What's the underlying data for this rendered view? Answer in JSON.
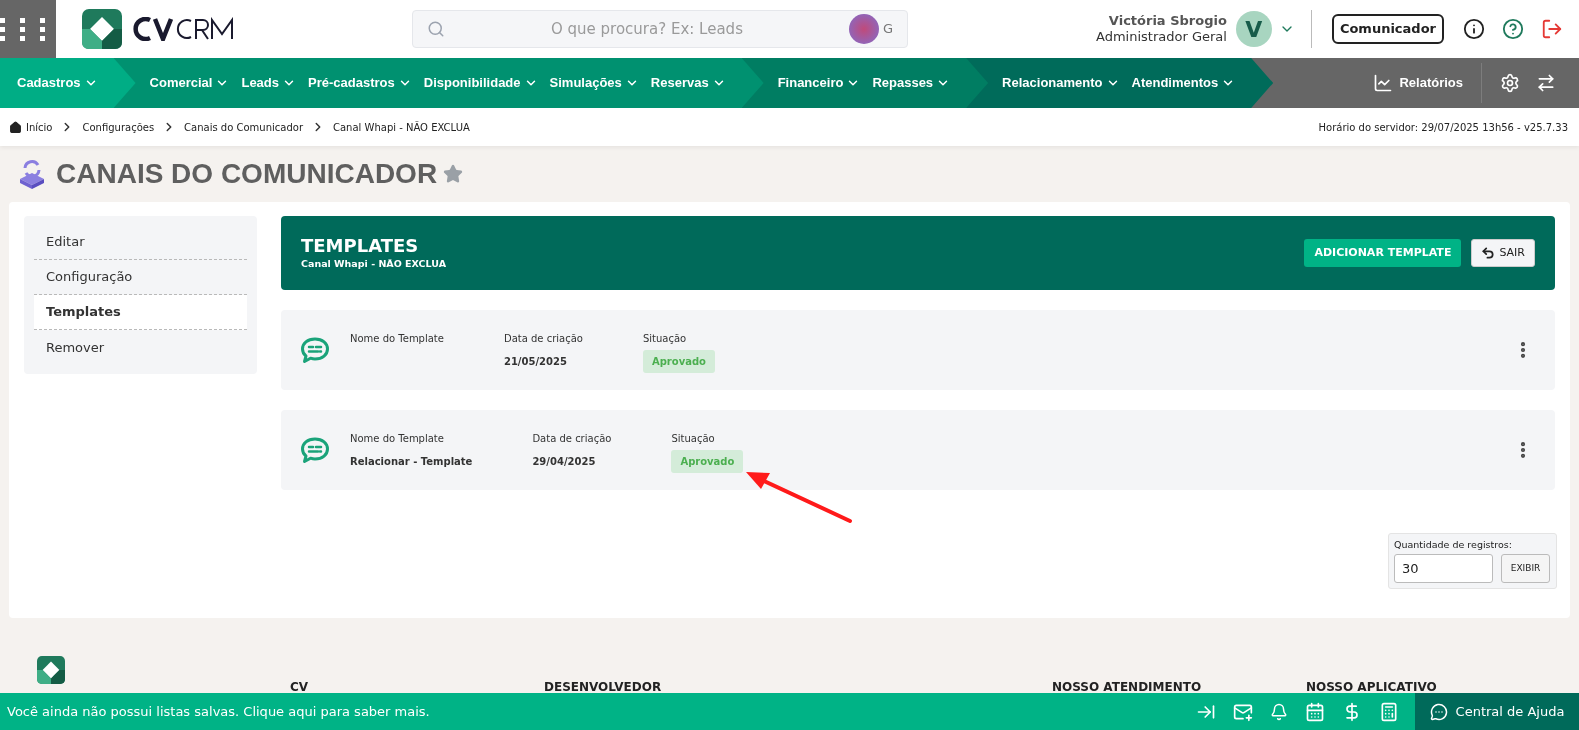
{
  "header": {
    "search": {
      "placeholder": "O que procura? Ex: Leads",
      "overlay_letter": "G"
    },
    "user": {
      "name": "Victória Sbrogio",
      "role": "Administrador Geral",
      "initial": "V"
    },
    "communicator_button": "Comunicador"
  },
  "nav": {
    "groups": [
      {
        "color": "#00ad85",
        "items": [
          "Cadastros"
        ]
      },
      {
        "color": "#009170",
        "items": [
          "Comercial",
          "Leads",
          "Pré-cadastros",
          "Disponibilidade",
          "Simulações",
          "Reservas"
        ]
      },
      {
        "color": "#007d62",
        "items": [
          "Financeiro",
          "Repasses"
        ]
      },
      {
        "color": "#006b5a",
        "items": [
          "Relacionamento",
          "Atendimentos"
        ]
      }
    ],
    "reports": "Relatórios"
  },
  "breadcrumb": [
    "Início",
    "Configurações",
    "Canais do Comunicador",
    "Canal Whapi - NÃO EXCLUA"
  ],
  "server_time": "Horário do servidor: 29/07/2025 13h56 - v25.7.33",
  "page_title": "CANAIS DO COMUNICADOR",
  "sidebar": {
    "items": [
      {
        "label": "Editar",
        "selected": false
      },
      {
        "label": "Configuração",
        "selected": false
      },
      {
        "label": "Templates",
        "selected": true
      },
      {
        "label": "Remover",
        "selected": false
      }
    ]
  },
  "panel": {
    "title": "TEMPLATES",
    "subtitle": "Canal Whapi - NÃO EXCLUA",
    "add_button": "ADICIONAR TEMPLATE",
    "exit_button": "SAIR"
  },
  "templates": [
    {
      "name_label": "Nome do Template",
      "date_label": "Data de criação",
      "date": "21/05/2025",
      "status_label": "Situação",
      "status": "Aprovado"
    },
    {
      "name_label": "Nome do Template",
      "name": "Relacionar - Template",
      "date_label": "Data de criação",
      "date": "29/04/2025",
      "status_label": "Situação",
      "status": "Aprovado"
    }
  ],
  "records": {
    "label": "Quantidade de registros:",
    "value": "30",
    "button": "EXIBIR"
  },
  "footer": {
    "headings": [
      "CV",
      "DESENVOLVEDOR",
      "NOSSO ATENDIMENTO",
      "NOSSO APLICATIVO"
    ]
  },
  "bottom_bar": {
    "message": "Você ainda não possui listas salvas. Clique aqui para saber mais.",
    "help": "Central de Ajuda"
  }
}
